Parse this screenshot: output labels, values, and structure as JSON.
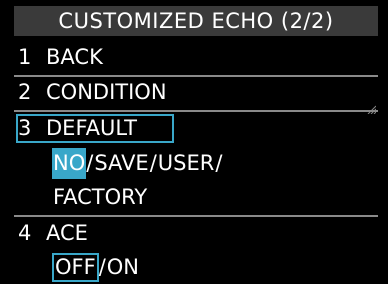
{
  "title": "CUSTOMIZED ECHO (2/2)",
  "items": [
    {
      "num": "1",
      "label": "BACK"
    },
    {
      "num": "2",
      "label": "CONDITION"
    },
    {
      "num": "3",
      "label": "DEFAULT"
    },
    {
      "num": "4",
      "label": "ACE"
    }
  ],
  "default_options": {
    "opt1": "NO",
    "opt2": "SAVE",
    "opt3": "USER",
    "opt4": "FACTORY",
    "sep": "/"
  },
  "ace_options": {
    "opt1": "OFF",
    "opt2": "ON",
    "sep": "/"
  },
  "colors": {
    "background": "#000000",
    "title_bar": "#3a3a3a",
    "accent": "#39a7c9",
    "text": "#ffffff"
  }
}
